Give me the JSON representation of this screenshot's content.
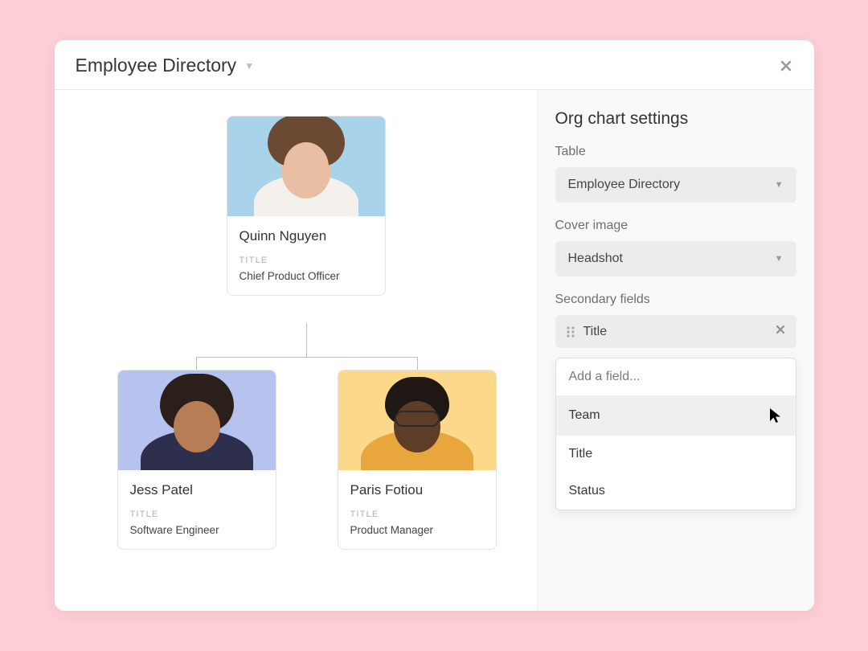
{
  "header": {
    "title": "Employee Directory"
  },
  "org": {
    "root": {
      "name": "Quinn Nguyen",
      "field_label": "TITLE",
      "field_value": "Chief Product Officer",
      "bg": "#a9d3eb"
    },
    "left": {
      "name": "Jess Patel",
      "field_label": "TITLE",
      "field_value": "Software Engineer",
      "bg": "#b6c3ef"
    },
    "right": {
      "name": "Paris Fotiou",
      "field_label": "TITLE",
      "field_value": "Product Manager",
      "bg": "#fbd88a"
    }
  },
  "panel": {
    "title": "Org chart settings",
    "table_label": "Table",
    "table_value": "Employee Directory",
    "cover_label": "Cover image",
    "cover_value": "Headshot",
    "secondary_label": "Secondary fields",
    "chip_value": "Title",
    "dropdown": {
      "placeholder": "Add a field...",
      "opt0": "Team",
      "opt1": "Title",
      "opt2": "Status"
    }
  }
}
